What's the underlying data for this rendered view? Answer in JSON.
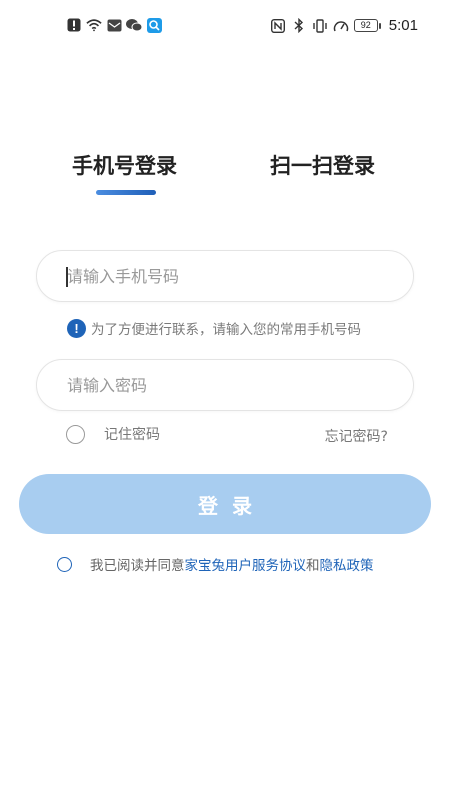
{
  "status_bar": {
    "time": "5:01",
    "battery": "92",
    "left_icons": [
      "alert-icon",
      "wifi-icon",
      "message-icon",
      "wechat-icon",
      "search-app-icon"
    ],
    "right_icons": [
      "nfc-icon",
      "bluetooth-icon",
      "vibrate-icon",
      "speed-icon"
    ]
  },
  "tabs": [
    {
      "label": "手机号登录",
      "active": true
    },
    {
      "label": "扫一扫登录",
      "active": false
    }
  ],
  "phone_input": {
    "placeholder": "请输入手机号码",
    "value": ""
  },
  "hint": {
    "icon": "info-icon",
    "text": "为了方便进行联系，请输入您的常用手机号码"
  },
  "password_input": {
    "placeholder": "请输入密码",
    "value": ""
  },
  "remember": {
    "label": "记住密码",
    "checked": false
  },
  "forgot": {
    "label": "忘记密码?"
  },
  "login_button": {
    "label": "登录"
  },
  "agreement": {
    "checked": false,
    "prefix": "我已阅读并同意",
    "service_link": "家宝兔用户服务协议",
    "connector": "和",
    "privacy_link": "隐私政策"
  },
  "colors": {
    "accent": "#1f64b8",
    "button_disabled": "#a8cdf0",
    "tab_underline_start": "#4b8de0",
    "tab_underline_end": "#1f5fb8"
  }
}
